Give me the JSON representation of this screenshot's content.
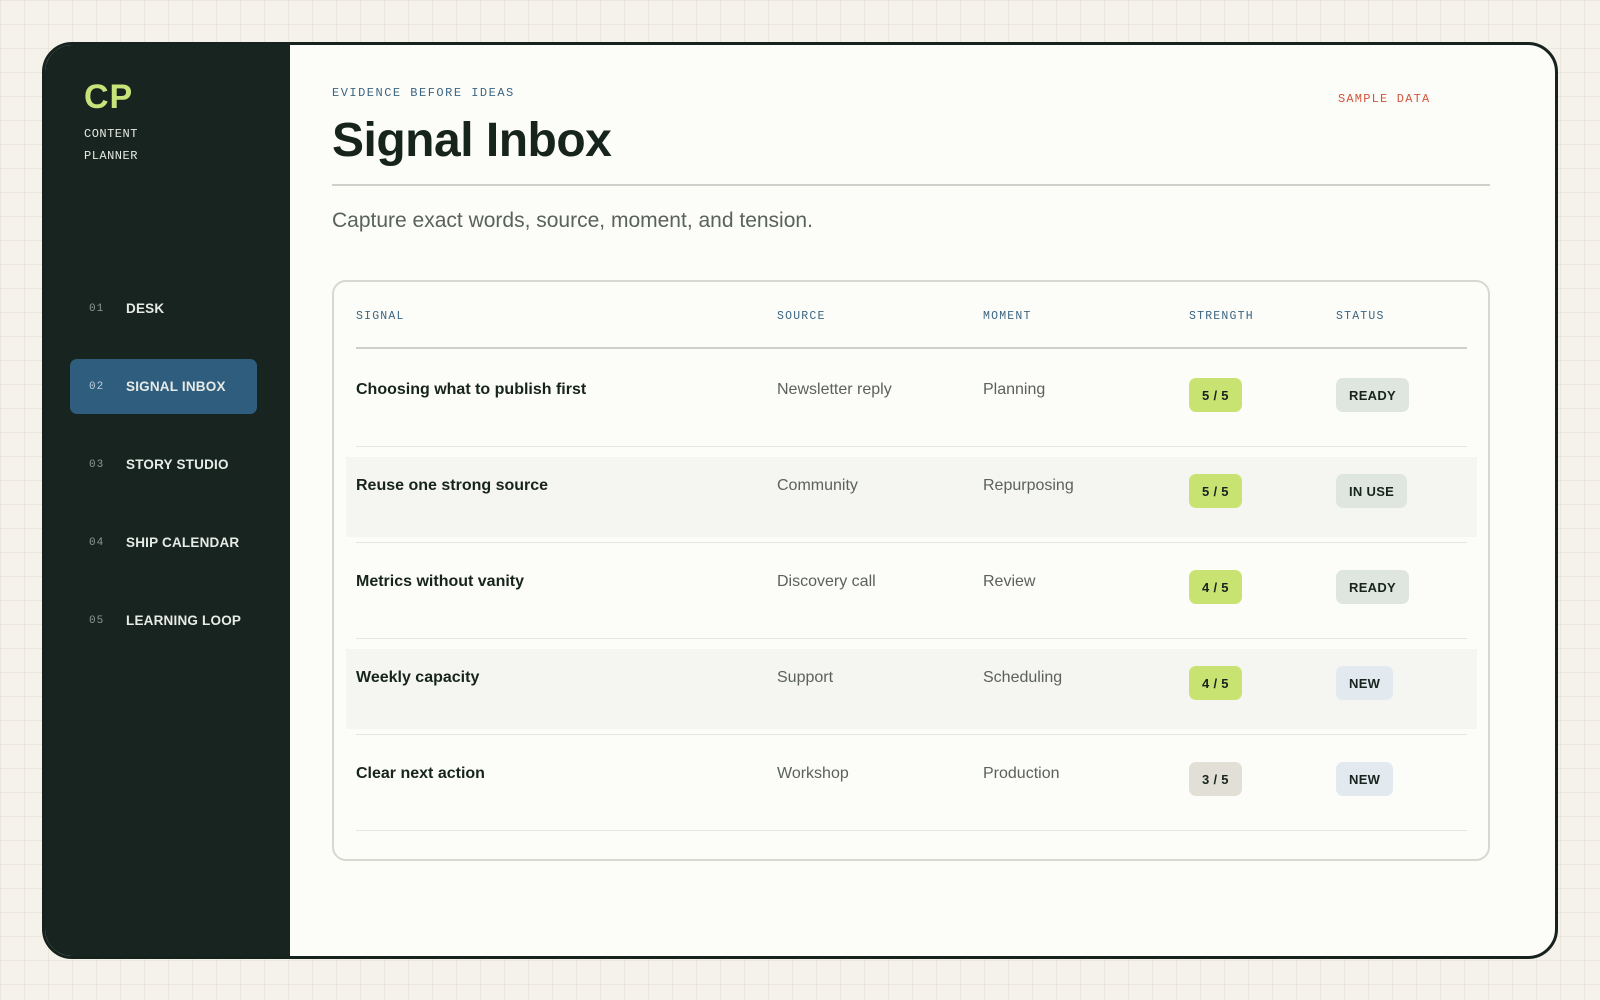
{
  "brand": {
    "mark": "CP",
    "subtitle": "CONTENT PLANNER"
  },
  "nav": [
    {
      "num": "01",
      "label": "DESK",
      "active": false
    },
    {
      "num": "02",
      "label": "SIGNAL INBOX",
      "active": true
    },
    {
      "num": "03",
      "label": "STORY STUDIO",
      "active": false
    },
    {
      "num": "04",
      "label": "SHIP CALENDAR",
      "active": false
    },
    {
      "num": "05",
      "label": "LEARNING LOOP",
      "active": false
    }
  ],
  "header": {
    "kicker": "EVIDENCE BEFORE IDEAS",
    "title": "Signal Inbox",
    "badge": "SAMPLE DATA",
    "subtitle": "Capture exact words, source, moment, and tension."
  },
  "table": {
    "columns": [
      "SIGNAL",
      "SOURCE",
      "MOMENT",
      "STRENGTH",
      "STATUS"
    ],
    "rows": [
      {
        "signal": "Choosing what to publish first",
        "source": "Newsletter reply",
        "moment": "Planning",
        "strength": "5 / 5",
        "status": "READY"
      },
      {
        "signal": "Reuse one strong source",
        "source": "Community",
        "moment": "Repurposing",
        "strength": "5 / 5",
        "status": "IN USE"
      },
      {
        "signal": "Metrics without vanity",
        "source": "Discovery call",
        "moment": "Review",
        "strength": "4 / 5",
        "status": "READY"
      },
      {
        "signal": "Weekly capacity",
        "source": "Support",
        "moment": "Scheduling",
        "strength": "4 / 5",
        "status": "NEW"
      },
      {
        "signal": "Clear next action",
        "source": "Workshop",
        "moment": "Production",
        "strength": "3 / 5",
        "status": "NEW"
      }
    ]
  },
  "colors": {
    "sidebar_bg": "#18241f",
    "accent_lime": "#c7e37a",
    "active_nav": "#2e5d7e",
    "kicker": "#3b6683",
    "sample_badge": "#d2543a",
    "strength_high": "#c8e372",
    "strength_low": "#e2dfd6",
    "status_ready": "#dfe6df",
    "status_in_use": "#dfe6df",
    "status_new": "#e2e9ef"
  }
}
